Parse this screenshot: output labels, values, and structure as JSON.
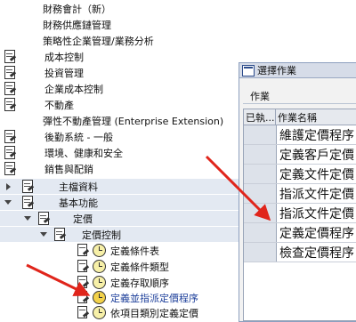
{
  "tree": {
    "items": [
      {
        "label": "財務會計（新）"
      },
      {
        "label": "財務供應鏈管理"
      },
      {
        "label": "策略性企業管理/業務分析"
      },
      {
        "label": "成本控制"
      },
      {
        "label": "投資管理"
      },
      {
        "label": "企業成本控制"
      },
      {
        "label": "不動產"
      },
      {
        "label": "彈性不動產管理 (Enterprise Extension)"
      },
      {
        "label": "後勤系統 - 一般"
      },
      {
        "label": "環境、健康和安全"
      },
      {
        "label": "銷售與配銷"
      },
      {
        "label": "主檔資料"
      },
      {
        "label": "基本功能"
      },
      {
        "label": "定價"
      },
      {
        "label": "定價控制"
      },
      {
        "label": "定義條件表"
      },
      {
        "label": "定義條件類型"
      },
      {
        "label": "定義存取順序"
      },
      {
        "label": "定義並指派定價程序"
      },
      {
        "label": "依項目類別定義定價"
      }
    ]
  },
  "dialog": {
    "title": "選擇作業",
    "section_label": "作業",
    "columns": [
      "已執...",
      "作業名稱"
    ],
    "rows": [
      {
        "name": "維護定價程序"
      },
      {
        "name": "定義客戶定價"
      },
      {
        "name": "定義文件定價"
      },
      {
        "name": "指派文件定價"
      },
      {
        "name": "指派文件定價"
      },
      {
        "name": "定義定價程序"
      },
      {
        "name": "檢查定價程序"
      }
    ]
  },
  "colors": {
    "arrow": "#e0251b",
    "highlight_row": "#e3e9f2"
  }
}
